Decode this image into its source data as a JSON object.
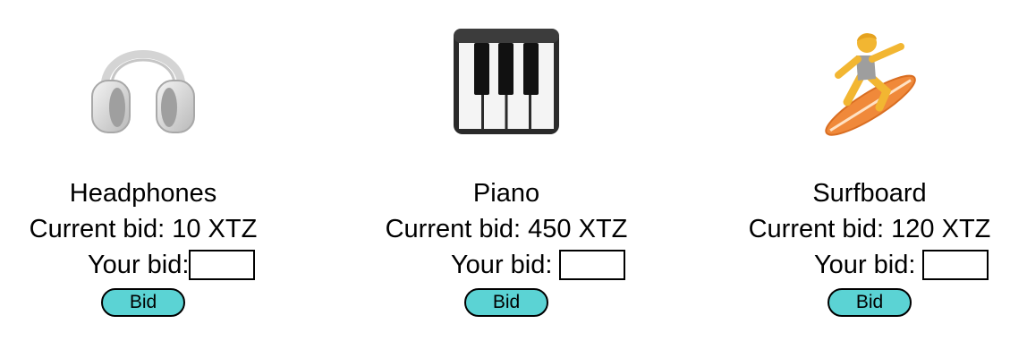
{
  "theme": {
    "button_color": "#5bd3d4"
  },
  "items": [
    {
      "icon": "headphones-icon",
      "name": "Headphones",
      "current_bid_text": "Current bid: 10 XTZ",
      "your_bid_label": "Your bid:",
      "input_value": "",
      "button_label": "Bid"
    },
    {
      "icon": "piano-keyboard-icon",
      "name": "Piano",
      "current_bid_text": "Current bid: 450 XTZ",
      "your_bid_label": "Your bid: ",
      "input_value": "",
      "button_label": "Bid"
    },
    {
      "icon": "surfer-icon",
      "name": "Surfboard",
      "current_bid_text": "Current bid: 120 XTZ",
      "your_bid_label": "Your bid: ",
      "input_value": "",
      "button_label": "Bid"
    }
  ]
}
